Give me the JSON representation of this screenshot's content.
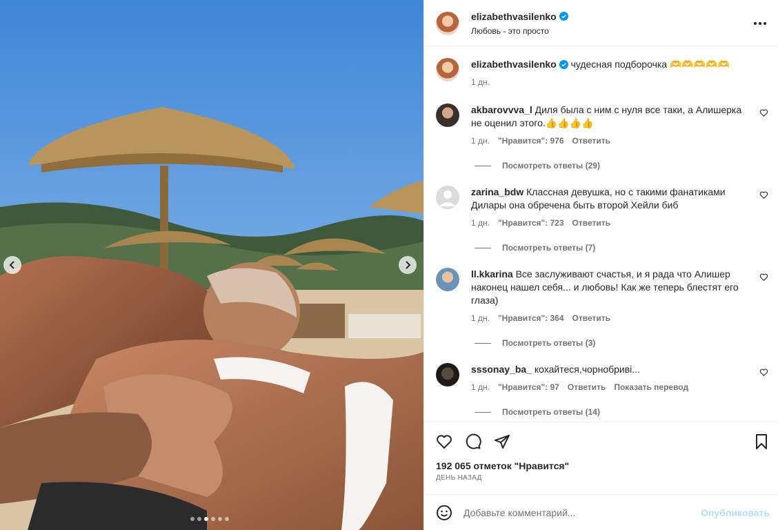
{
  "post": {
    "username": "elizabethvasilenko",
    "subtitle": "Любовь - это просто",
    "caption_text": "чудесная подборочка 🫶🫶🫶🫶🫶",
    "caption_time": "1 дн."
  },
  "media": {
    "slide_count": 6,
    "active_slide": 3
  },
  "comments": [
    {
      "username": "akbarovvva_l",
      "text": "Диля была с ним с нуля все таки, а Алишерка не оценил этого.👍👍👍👍",
      "time": "1 дн.",
      "likes": "\"Нравится\": 976",
      "reply": "Ответить",
      "translate": "",
      "replies": "Посмотреть ответы (29)"
    },
    {
      "username": "zarina_bdw",
      "text": "Классная девушка, но с такими фанатиками Дилары она обречена быть второй Хейли биб",
      "time": "1 дн.",
      "likes": "\"Нравится\": 723",
      "reply": "Ответить",
      "translate": "",
      "replies": "Посмотреть ответы (7)"
    },
    {
      "username": "ll.kkarina",
      "text": "Все заслуживают счастья, и я рада что Алишер наконец нашел себя... и любовь! Как же теперь блестят его глаза)",
      "time": "1 дн.",
      "likes": "\"Нравится\": 364",
      "reply": "Ответить",
      "translate": "",
      "replies": "Посмотреть ответы (3)"
    },
    {
      "username": "sssonay_ba_",
      "text": "кохайтеся,чорнобриві...",
      "time": "1 дн.",
      "likes": "\"Нравится\": 97",
      "reply": "Ответить",
      "translate": "Показать перевод",
      "replies": "Посмотреть ответы (14)"
    }
  ],
  "likes_count": "192 065 отметок \"Нравится\"",
  "time_ago": "День назад",
  "add_comment": {
    "placeholder": "Добавьте комментарий...",
    "publish": "Опубликовать"
  },
  "icons": {
    "heart": "heart-icon",
    "comment": "comment-icon",
    "share": "share-icon",
    "save": "bookmark-icon",
    "more": "more-icon",
    "emoji": "emoji-icon",
    "verified": "verified-icon"
  },
  "colors": {
    "verified": "#0095f6",
    "publish_disabled": "#b2dffc",
    "secondary_text": "#737373"
  }
}
